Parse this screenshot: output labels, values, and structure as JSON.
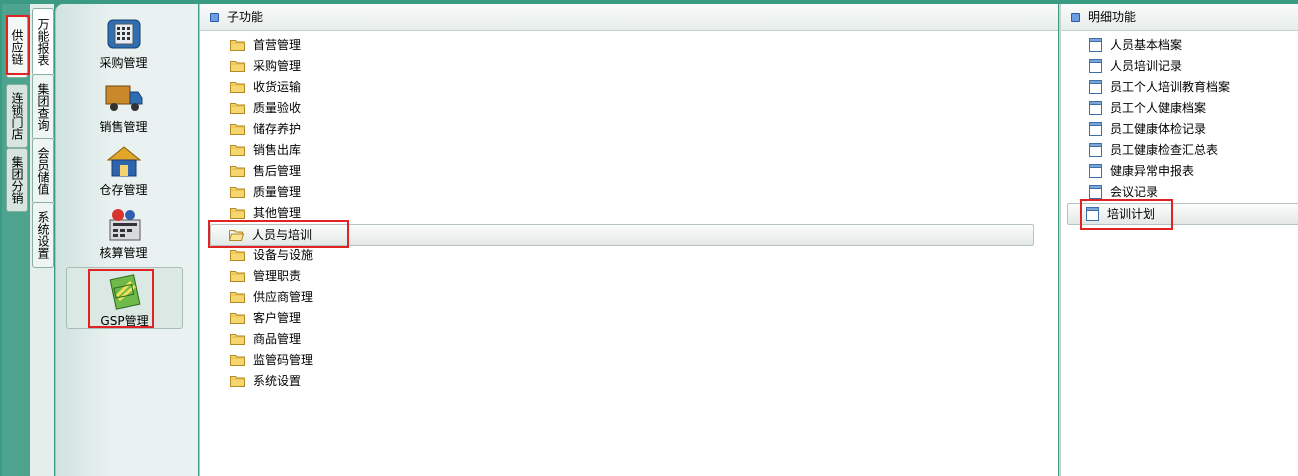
{
  "outer_tabs": [
    {
      "label": "供应链",
      "active": true
    },
    {
      "label": "连锁门店",
      "active": false
    },
    {
      "label": "集团分销",
      "active": false
    }
  ],
  "inner_tabs": [
    {
      "label": "万能报表",
      "active": true
    },
    {
      "label": "集团查询",
      "active": false
    },
    {
      "label": "会员储值",
      "active": false
    },
    {
      "label": "系统设置",
      "active": false
    }
  ],
  "modules": [
    {
      "label": "采购管理",
      "icon": "purchase-phone-icon"
    },
    {
      "label": "销售管理",
      "icon": "sales-truck-icon"
    },
    {
      "label": "仓存管理",
      "icon": "warehouse-house-icon"
    },
    {
      "label": "核算管理",
      "icon": "accounting-calculator-icon"
    },
    {
      "label": "GSP管理",
      "icon": "gsp-certificate-icon",
      "selected": true
    }
  ],
  "subfunctions": {
    "title": "子功能",
    "items": [
      "首营管理",
      "采购管理",
      "收货运输",
      "质量验收",
      "储存养护",
      "销售出库",
      "售后管理",
      "质量管理",
      "其他管理",
      "人员与培训",
      "设备与设施",
      "管理职责",
      "供应商管理",
      "客户管理",
      "商品管理",
      "监管码管理",
      "系统设置"
    ],
    "selected_index": 9
  },
  "details": {
    "title": "明细功能",
    "items": [
      "人员基本档案",
      "人员培训记录",
      "员工个人培训教育档案",
      "员工个人健康档案",
      "员工健康体检记录",
      "员工健康检查汇总表",
      "健康异常申报表",
      "会议记录",
      "培训计划"
    ],
    "selected_index": 8
  },
  "colors": {
    "highlight": "#e02424",
    "background": "#3a9a82"
  }
}
